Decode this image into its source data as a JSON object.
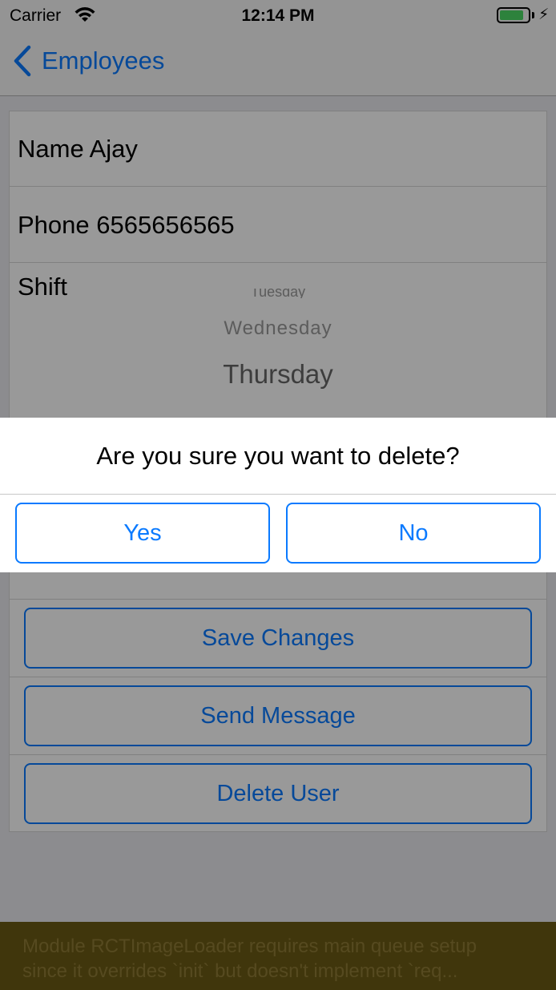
{
  "status_bar": {
    "carrier": "Carrier",
    "time": "12:14 PM",
    "icons": [
      "wifi-icon",
      "battery-icon",
      "charging-bolt-icon"
    ],
    "battery_level": 0.85
  },
  "nav": {
    "back_label": "Employees",
    "accent_color": "#0a7aff"
  },
  "form": {
    "name_text": "Name Ajay",
    "phone_text": "Phone 6565656565",
    "shift_label": "Shift",
    "shift_picker": {
      "items": [
        "Tuesday",
        "Wednesday",
        "Thursday"
      ]
    }
  },
  "actions": {
    "save_label": "Save Changes",
    "send_label": "Send Message",
    "delete_label": "Delete User"
  },
  "alert": {
    "message": "Are you sure you want to delete?",
    "yes_label": "Yes",
    "no_label": "No"
  },
  "warning": {
    "line1": "Module RCTImageLoader requires main queue setup",
    "line2": "since it overrides `init` but doesn't implement `req..."
  }
}
